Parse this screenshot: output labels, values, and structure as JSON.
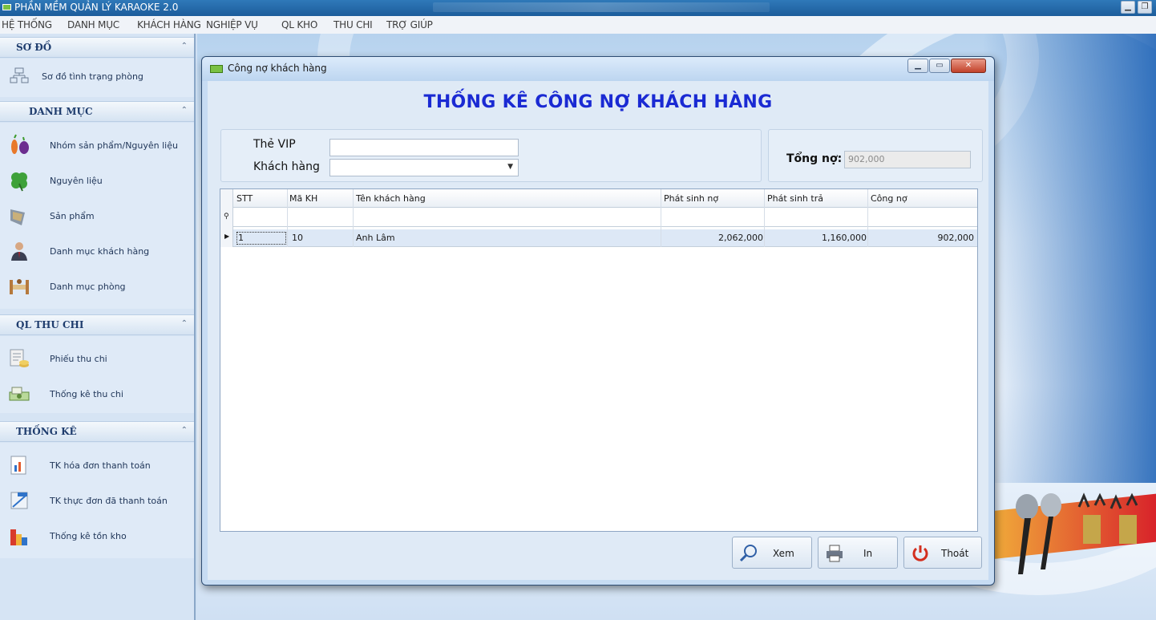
{
  "app": {
    "title": "PHẦN MỀM QUẢN LÝ KARAOKE 2.0"
  },
  "menubar": [
    "HỆ THỐNG",
    "DANH MỤC",
    "KHÁCH HÀNG",
    "NGHIỆP VỤ",
    "QL KHO",
    "THU CHI",
    "TRỢ GIÚP"
  ],
  "sidebar": {
    "groups": [
      {
        "title": "SƠ ĐỒ",
        "items": [
          {
            "label": "Sơ đồ tình trạng phòng",
            "icon": "room-status-icon"
          }
        ]
      },
      {
        "title": "DANH MỤC",
        "items": [
          {
            "label": "Nhóm sản phẩm/Nguyên liệu",
            "icon": "vegetables-icon"
          },
          {
            "label": "Nguyên liệu",
            "icon": "clover-icon"
          },
          {
            "label": "Sản phẩm",
            "icon": "product-icon"
          },
          {
            "label": "Danh mục khách hàng",
            "icon": "customer-icon"
          },
          {
            "label": "Danh mục phòng",
            "icon": "room-icon"
          }
        ]
      },
      {
        "title": "QL THU CHI",
        "items": [
          {
            "label": "Phiếu thu chi",
            "icon": "receipt-icon"
          },
          {
            "label": "Thống kê thu chi",
            "icon": "money-icon"
          }
        ]
      },
      {
        "title": "THỐNG KÊ",
        "items": [
          {
            "label": "TK hóa đơn thanh toán",
            "icon": "invoice-chart-icon"
          },
          {
            "label": "TK thực đơn đã thanh toán",
            "icon": "menu-report-icon"
          },
          {
            "label": "Thống kê tồn kho",
            "icon": "inventory-chart-icon"
          }
        ]
      }
    ]
  },
  "dialog": {
    "title": "Công nợ khách hàng",
    "heading": "THỐNG KÊ CÔNG NỢ KHÁCH HÀNG",
    "filters": {
      "vip_label": "Thẻ VIP",
      "vip_value": "",
      "customer_label": "Khách hàng",
      "customer_value": ""
    },
    "total": {
      "label": "Tổng nợ:",
      "value": "902,000"
    },
    "grid": {
      "columns": [
        "STT",
        "Mã KH",
        "Tên khách hàng",
        "Phát sinh nợ",
        "Phát sinh trả",
        "Công nợ"
      ],
      "rows": [
        [
          "1",
          "10",
          "Anh Lâm",
          "2,062,000",
          "1,160,000",
          "902,000"
        ]
      ]
    },
    "buttons": {
      "view": "Xem",
      "print": "In",
      "exit": "Thoát"
    }
  },
  "colors": {
    "heading": "#1a2ad3",
    "sidebar_bg": "#dfeaf7",
    "group_title": "#1f3d6e"
  }
}
